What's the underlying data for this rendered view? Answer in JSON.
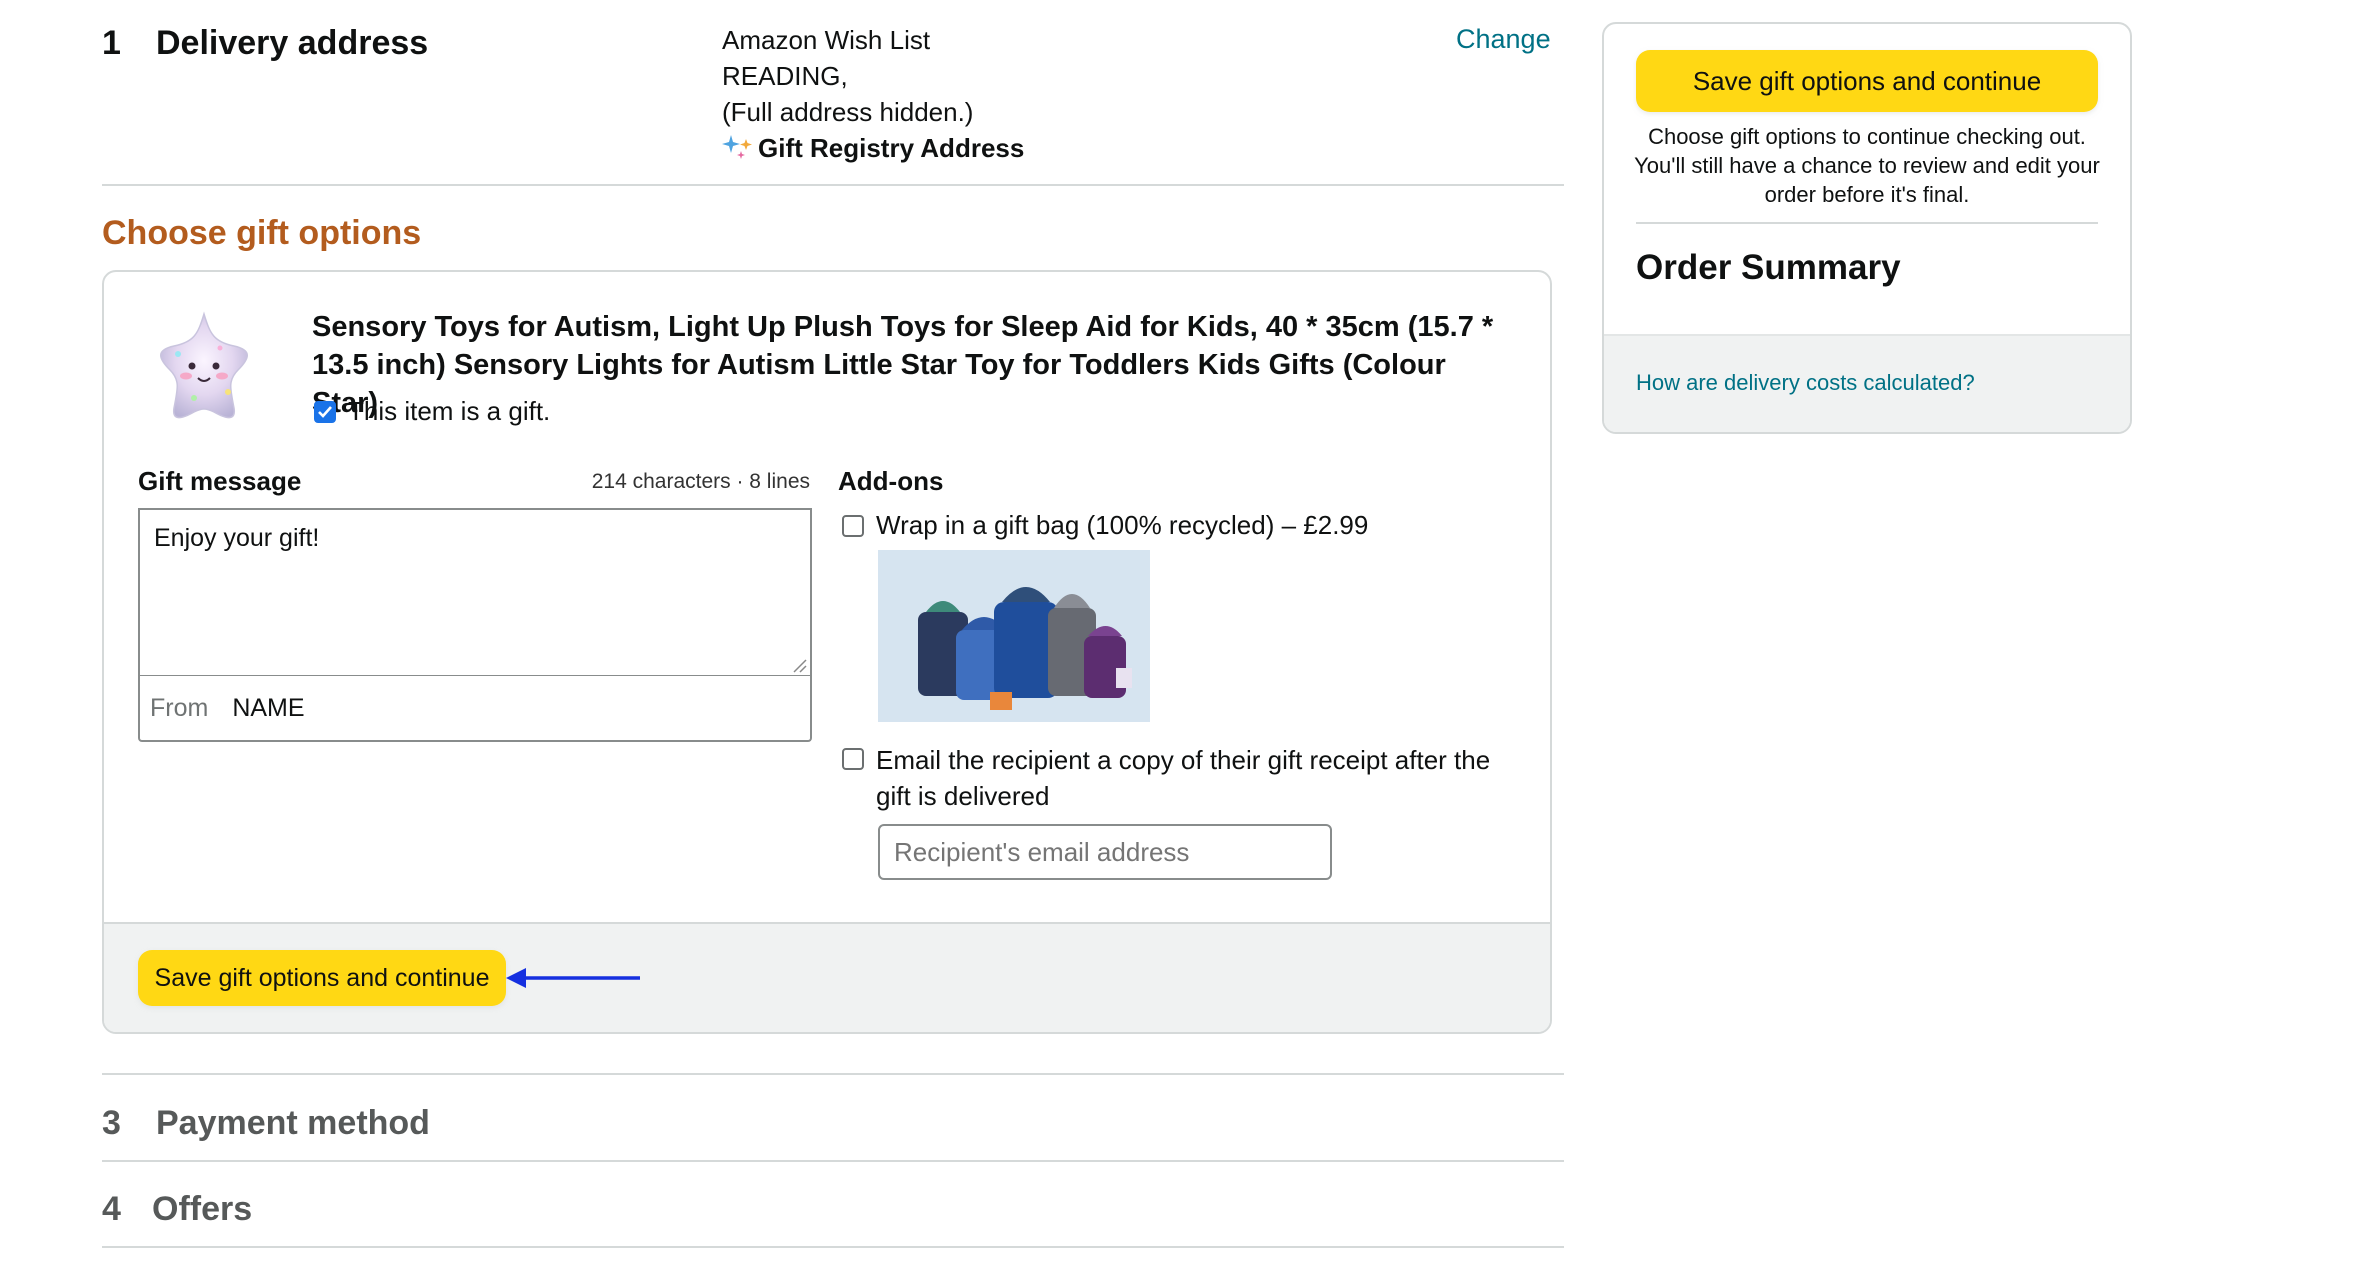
{
  "delivery": {
    "step_number": "1",
    "title": "Delivery address",
    "address_lines": [
      "Amazon Wish List",
      "READING,",
      "(Full address hidden.)"
    ],
    "registry_label": "Gift Registry Address",
    "change_link": "Change"
  },
  "gift_options": {
    "heading": "Choose gift options",
    "product_title": "Sensory Toys for Autism, Light Up Plush Toys for Sleep Aid for Kids, 40 * 35cm (15.7 * 13.5 inch) Sensory Lights for Autism Little Star Toy for Toddlers Kids Gifts (Colour Star)",
    "is_gift_label": "This item is a gift.",
    "is_gift_checked": true,
    "message_label": "Gift message",
    "message_limit": "214 characters · 8 lines",
    "message_value": "Enjoy your gift!",
    "from_label": "From",
    "from_value": "NAME",
    "addons_label": "Add-ons",
    "wrap_label": "Wrap in a gift bag (100% recycled) – £2.99",
    "wrap_checked": false,
    "email_receipt_label": "Email the recipient a copy of their gift receipt after the gift is delivered",
    "email_receipt_checked": false,
    "email_placeholder": "Recipient's email address",
    "save_button": "Save gift options and continue"
  },
  "payment": {
    "step_number": "3",
    "title": "Payment method"
  },
  "offers": {
    "step_number": "4",
    "title": "Offers"
  },
  "summary": {
    "save_button": "Save gift options and continue",
    "note": "Choose gift options to continue checking out. You'll still have a chance to review and edit your order before it's final.",
    "title": "Order Summary",
    "delivery_costs_link": "How are delivery costs calculated?"
  },
  "colors": {
    "button_yellow": "#ffd814",
    "heading_orange": "#b35c1e",
    "link_teal": "#007185",
    "annotation_arrow": "#1530e0"
  }
}
